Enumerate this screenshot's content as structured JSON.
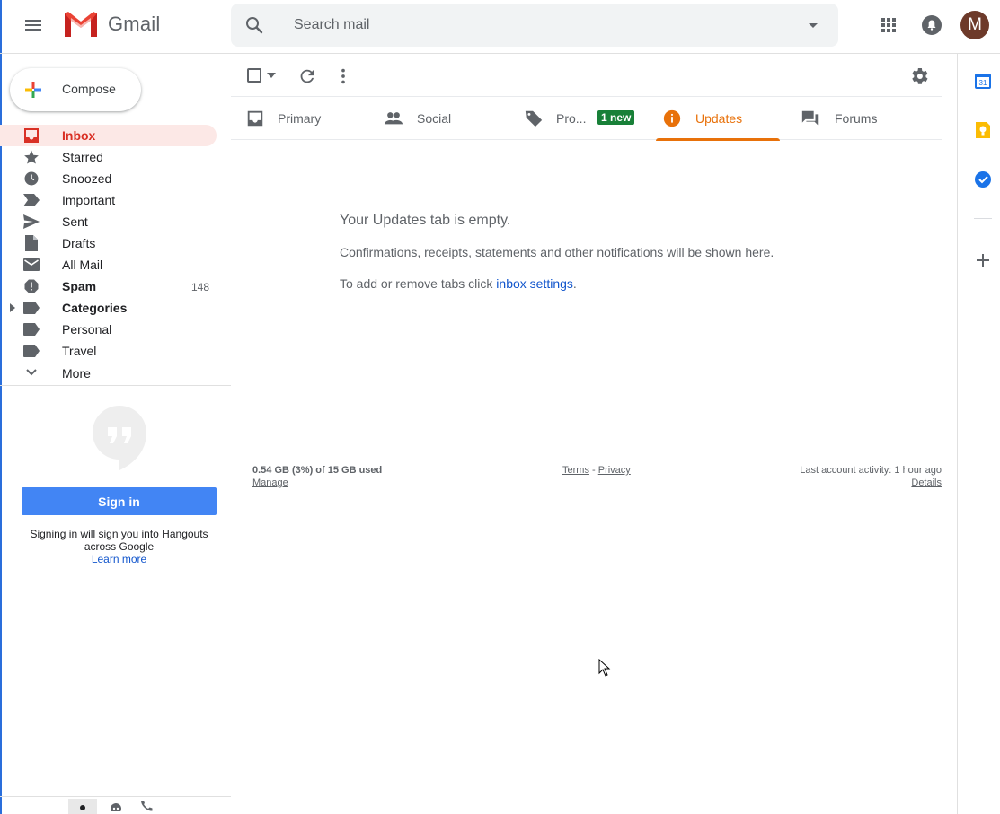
{
  "header": {
    "app_name": "Gmail",
    "search_placeholder": "Search mail",
    "avatar_letter": "M"
  },
  "compose": {
    "label": "Compose"
  },
  "sidebar": {
    "items": [
      {
        "label": "Inbox",
        "icon": "inbox-icon",
        "count": "",
        "active": true
      },
      {
        "label": "Starred",
        "icon": "star-icon",
        "count": ""
      },
      {
        "label": "Snoozed",
        "icon": "clock-icon",
        "count": ""
      },
      {
        "label": "Important",
        "icon": "important-icon",
        "count": ""
      },
      {
        "label": "Sent",
        "icon": "send-icon",
        "count": ""
      },
      {
        "label": "Drafts",
        "icon": "draft-icon",
        "count": ""
      },
      {
        "label": "All Mail",
        "icon": "mail-icon",
        "count": ""
      },
      {
        "label": "Spam",
        "icon": "spam-icon",
        "count": "148"
      },
      {
        "label": "Categories",
        "icon": "label-icon",
        "count": ""
      },
      {
        "label": "Personal",
        "icon": "label-icon",
        "count": ""
      },
      {
        "label": "Travel",
        "icon": "label-icon",
        "count": ""
      },
      {
        "label": "More",
        "icon": "chevron-down-icon",
        "count": ""
      }
    ]
  },
  "hangouts": {
    "signin_label": "Sign in",
    "note": "Signing in will sign you into Hangouts across Google",
    "learn_more": "Learn more"
  },
  "tabs": [
    {
      "label": "Primary",
      "icon": "inbox-icon"
    },
    {
      "label": "Social",
      "icon": "people-icon"
    },
    {
      "label": "Pro...",
      "icon": "tag-icon",
      "badge": "1 new"
    },
    {
      "label": "Updates",
      "icon": "info-icon",
      "active": true
    },
    {
      "label": "Forums",
      "icon": "forum-icon"
    }
  ],
  "empty_state": {
    "title": "Your Updates tab is empty.",
    "description": "Confirmations, receipts, statements and other notifications will be shown here.",
    "tip_prefix": "To add or remove tabs click ",
    "tip_link": "inbox settings",
    "tip_suffix": "."
  },
  "footer": {
    "storage": "0.54 GB (3%) of 15 GB used",
    "manage": "Manage",
    "terms": "Terms",
    "separator": " - ",
    "privacy": "Privacy",
    "activity": "Last account activity: 1 hour ago",
    "details": "Details"
  },
  "rail": {
    "calendar_day": "31"
  },
  "colors": {
    "accent_red": "#d93025",
    "active_bg": "#fce8e6",
    "updates_orange": "#e8710a",
    "badge_green": "#188038",
    "signin_blue": "#4285f4",
    "link_blue": "#1155cc"
  }
}
